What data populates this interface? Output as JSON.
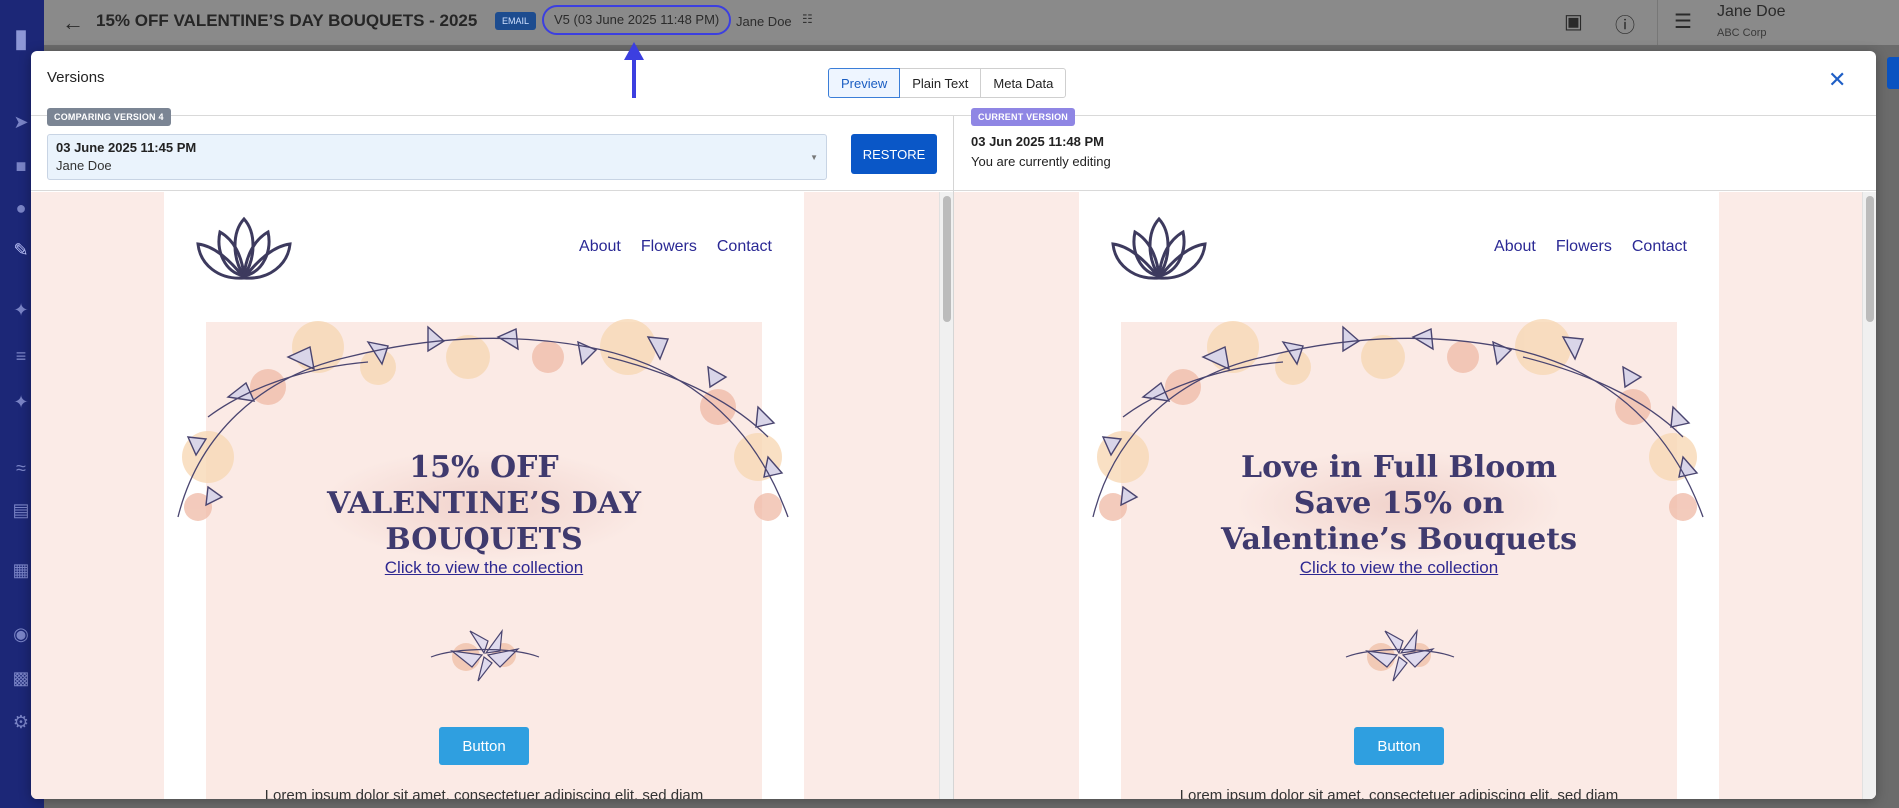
{
  "app": {
    "campaign_title": "15% OFF VALENTINE’S DAY BOUQUETS - 2025",
    "channel_badge": "EMAIL",
    "version_pill": "V5 (03 June 2025 11:48 PM)",
    "owner": "Jane Doe",
    "user_name": "Jane Doe",
    "user_org": "ABC Corp"
  },
  "modal": {
    "title": "Versions",
    "tabs": [
      {
        "label": "Preview",
        "active": true
      },
      {
        "label": "Plain Text",
        "active": false
      },
      {
        "label": "Meta Data",
        "active": false
      }
    ],
    "close_label": "✕"
  },
  "compare": {
    "tag": "COMPARING VERSION 4",
    "selected_date": "03 June 2025 11:45 PM",
    "selected_author": "Jane Doe",
    "restore_label": "RESTORE"
  },
  "current": {
    "tag": "CURRENT VERSION",
    "date": "03 Jun 2025 11:48 PM",
    "note": "You are currently editing"
  },
  "nav_links": [
    "About",
    "Flowers",
    "Contact"
  ],
  "left_preview": {
    "headline": [
      "15% OFF",
      "VALENTINE’S DAY",
      "BOUQUETS"
    ],
    "link": "Click to view the collection",
    "button": "Button",
    "body": "Lorem ipsum dolor sit amet, consectetuer adipiscing elit, sed diam"
  },
  "right_preview": {
    "headline": [
      "Love in Full Bloom",
      "Save 15% on",
      "Valentine’s Bouquets"
    ],
    "link": "Click to view the collection",
    "button": "Button",
    "body": "Lorem ipsum dolor sit amet, consectetuer adipiscing elit, sed diam"
  },
  "colors": {
    "accent": "#0a57c7",
    "annotation": "#3c3fe0",
    "nav_link": "#2a2894",
    "headline": "#3f3a6e",
    "email_bg": "#fbeae5",
    "cta": "#2f9fe0"
  },
  "icons": {
    "back": "arrow-left-icon",
    "comment": "chat-icon",
    "help": "help-icon",
    "menu": "hamburger-icon",
    "owner": "user-search-icon",
    "caret": "caret-down-icon"
  }
}
